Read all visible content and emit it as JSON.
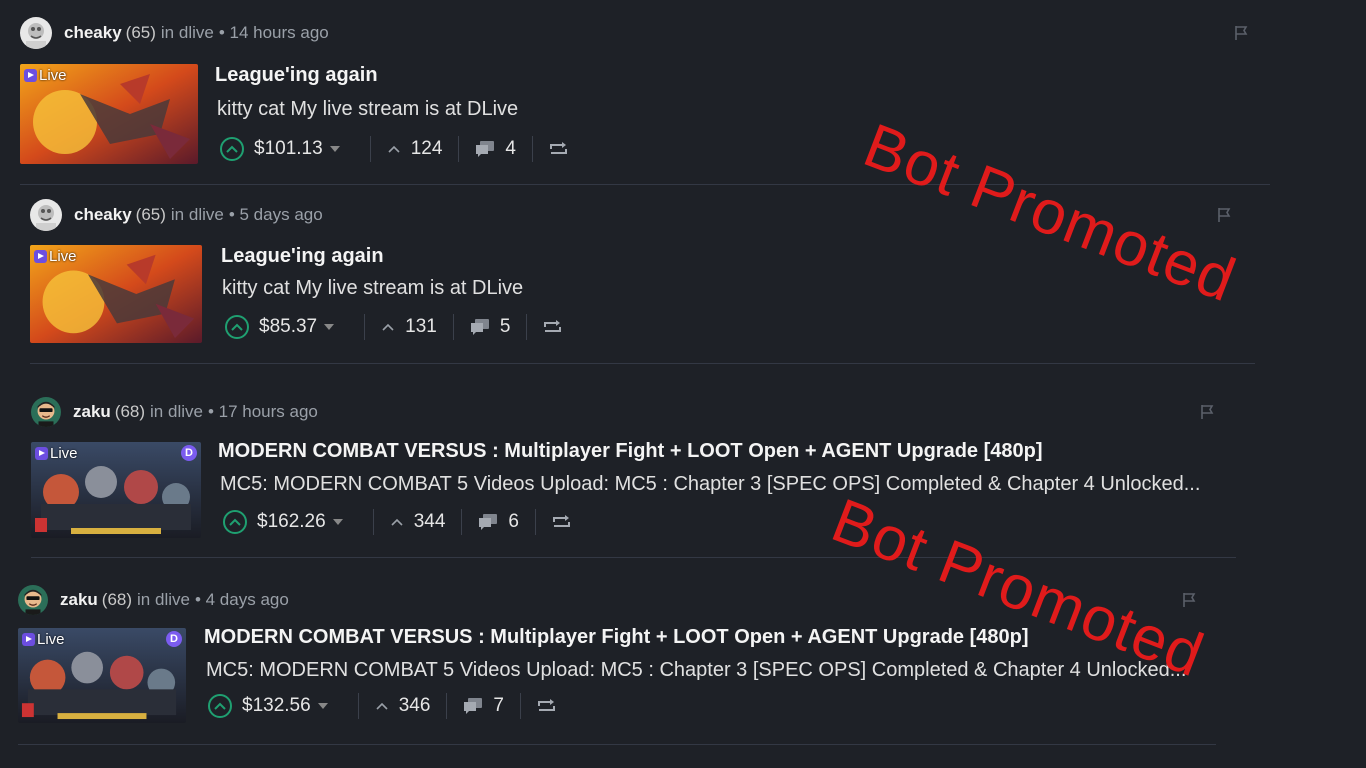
{
  "posts": [
    {
      "author": "cheaky",
      "reputation": "(65)",
      "community": "in dlive",
      "time": "• 14 hours ago",
      "live_label": "Live",
      "title": "League'ing again",
      "summary": "kitty cat My live stream is at DLive",
      "payout": "$101.13",
      "votes": "124",
      "comments": "4"
    },
    {
      "author": "cheaky",
      "reputation": "(65)",
      "community": "in dlive",
      "time": "• 5 days ago",
      "live_label": "Live",
      "title": "League'ing again",
      "summary": "kitty cat My live stream is at DLive",
      "payout": "$85.37",
      "votes": "131",
      "comments": "5"
    },
    {
      "author": "zaku",
      "reputation": "(68)",
      "community": "in dlive",
      "time": "• 17 hours ago",
      "live_label": "Live",
      "title": "MODERN COMBAT VERSUS : Multiplayer Fight + LOOT Open + AGENT Upgrade [480p]",
      "summary": "MC5: MODERN COMBAT 5 Videos Upload: MC5 : Chapter 3 [SPEC OPS] Completed & Chapter 4 Unlocked...",
      "payout": "$162.26",
      "votes": "344",
      "comments": "6"
    },
    {
      "author": "zaku",
      "reputation": "(68)",
      "community": "in dlive",
      "time": "• 4 days ago",
      "live_label": "Live",
      "title": "MODERN COMBAT VERSUS : Multiplayer Fight + LOOT Open + AGENT Upgrade [480p]",
      "summary": "MC5: MODERN COMBAT 5 Videos Upload: MC5 : Chapter 3 [SPEC OPS] Completed & Chapter 4 Unlocked...",
      "payout": "$132.56",
      "votes": "346",
      "comments": "7"
    }
  ],
  "watermarks": [
    "Bot Promoted",
    "Bot Promoted"
  ],
  "colors": {
    "background": "#1e2127",
    "upvote": "#1fa071",
    "watermark": "#e01b1b"
  },
  "icons": [
    "avatar",
    "live-badge-icon",
    "flag-icon",
    "upvote-icon",
    "caret-down-icon",
    "chevron-up-icon",
    "comments-icon",
    "reblog-icon"
  ]
}
